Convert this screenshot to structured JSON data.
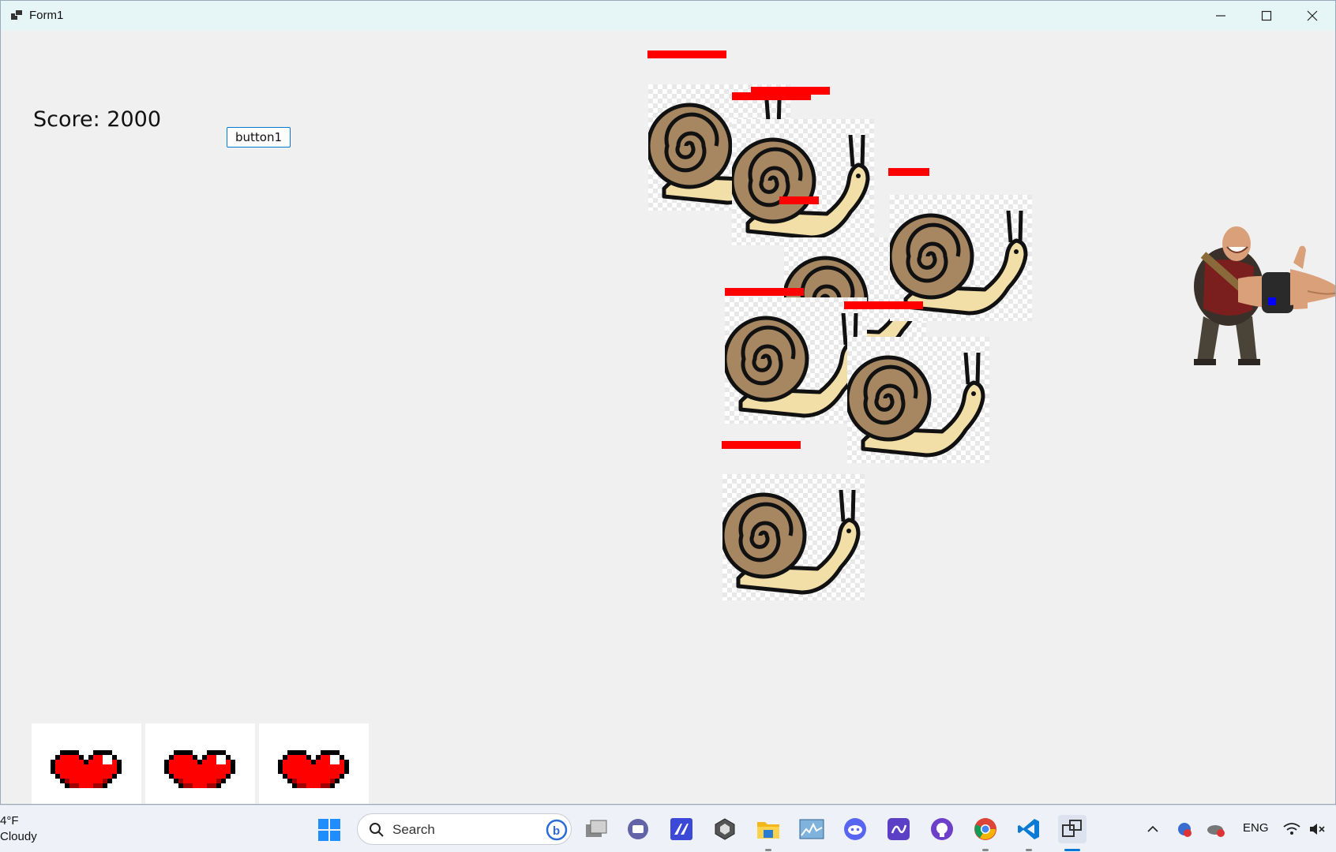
{
  "window": {
    "title": "Form1",
    "minimize_label": "—",
    "maximize_label": "☐",
    "close_label": "✕"
  },
  "game": {
    "score_text": "Score: 2000",
    "button_label": "button1",
    "lives": 3
  },
  "taskbar": {
    "weather_temp": "4°F",
    "weather_condition": "Cloudy",
    "search_placeholder": "Search",
    "language": "ENG",
    "pinned_apps": [
      "task-view",
      "teams",
      "visual-studio",
      "unity",
      "file-explorer",
      "performance-monitor",
      "discord",
      "pen",
      "github",
      "chrome",
      "vscode",
      "windows-forms-app"
    ]
  },
  "colors": {
    "health_bar": "#ff0000",
    "heart": "#ff0000",
    "snail_shell": "#a68762",
    "snail_body": "#f2dfa7",
    "button_border": "#0078d4"
  }
}
